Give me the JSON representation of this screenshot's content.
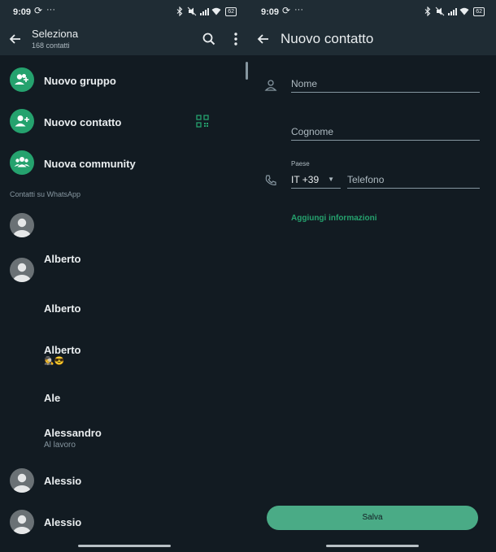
{
  "colors": {
    "accent": "#25a26e",
    "bar": "#1f2c34",
    "background": "#121b22"
  },
  "status": {
    "time": "9:09",
    "battery": "62"
  },
  "left": {
    "title": "Seleziona",
    "subtitle": "168 contatti",
    "actions": [
      {
        "label": "Nuovo gruppo",
        "icon": "group-add-icon"
      },
      {
        "label": "Nuovo contatto",
        "icon": "person-add-icon"
      },
      {
        "label": "Nuova community",
        "icon": "community-icon"
      }
    ],
    "section_label": "Contatti su WhatsApp",
    "contacts": [
      {
        "name": "",
        "status": "",
        "avatar": true
      },
      {
        "name": "Alberto",
        "status": "",
        "avatar": true
      },
      {
        "name": "Alberto",
        "status": "",
        "avatar": false
      },
      {
        "name": "Alberto",
        "status": "🕵😎",
        "avatar": false
      },
      {
        "name": "Ale",
        "status": "",
        "avatar": false
      },
      {
        "name": "Alessandro",
        "status": "Al lavoro",
        "avatar": false
      },
      {
        "name": "Alessio",
        "status": "",
        "avatar": true
      },
      {
        "name": "Alessio",
        "status": "",
        "avatar": true
      }
    ]
  },
  "right": {
    "title": "Nuovo contatto",
    "first_name_placeholder": "Nome",
    "last_name_placeholder": "Cognome",
    "country_label": "Paese",
    "country_value": "IT +39",
    "phone_placeholder": "Telefono",
    "add_info_link": "Aggiungi informazioni",
    "save_button": "Salva"
  }
}
